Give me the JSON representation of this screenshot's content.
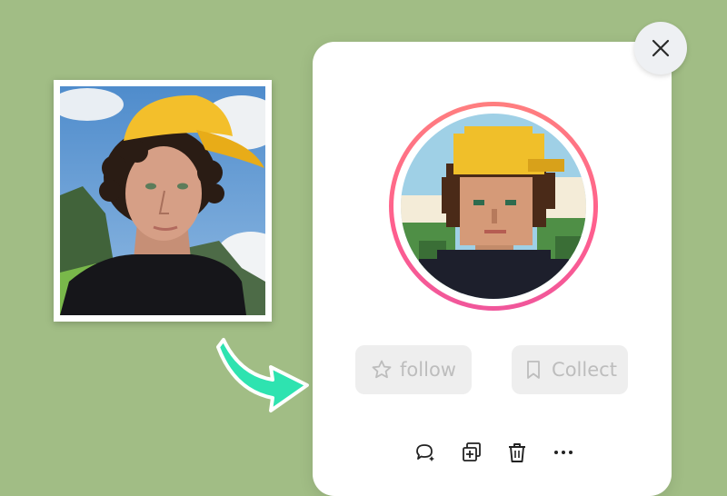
{
  "original_photo": {
    "subject": "teen-with-yellow-cap-photo",
    "colors": {
      "cap": "#f3bf2b",
      "sky": "#5f97cf",
      "shirt": "#16161a",
      "hair": "#2a1c14"
    }
  },
  "arrow": {
    "icon": "curved-arrow-icon",
    "color": "#2ee3b0"
  },
  "profile_card": {
    "avatar": {
      "style": "pixel-art",
      "ring_colors": [
        "#ff7f7f",
        "#f0569b"
      ]
    },
    "follow_label": "follow",
    "collect_label": "Collect",
    "toolbar": [
      {
        "icon": "comment-sparkle-icon"
      },
      {
        "icon": "add-copy-icon"
      },
      {
        "icon": "trash-icon"
      },
      {
        "icon": "more-icon"
      }
    ]
  },
  "close": {
    "icon": "close-icon"
  }
}
